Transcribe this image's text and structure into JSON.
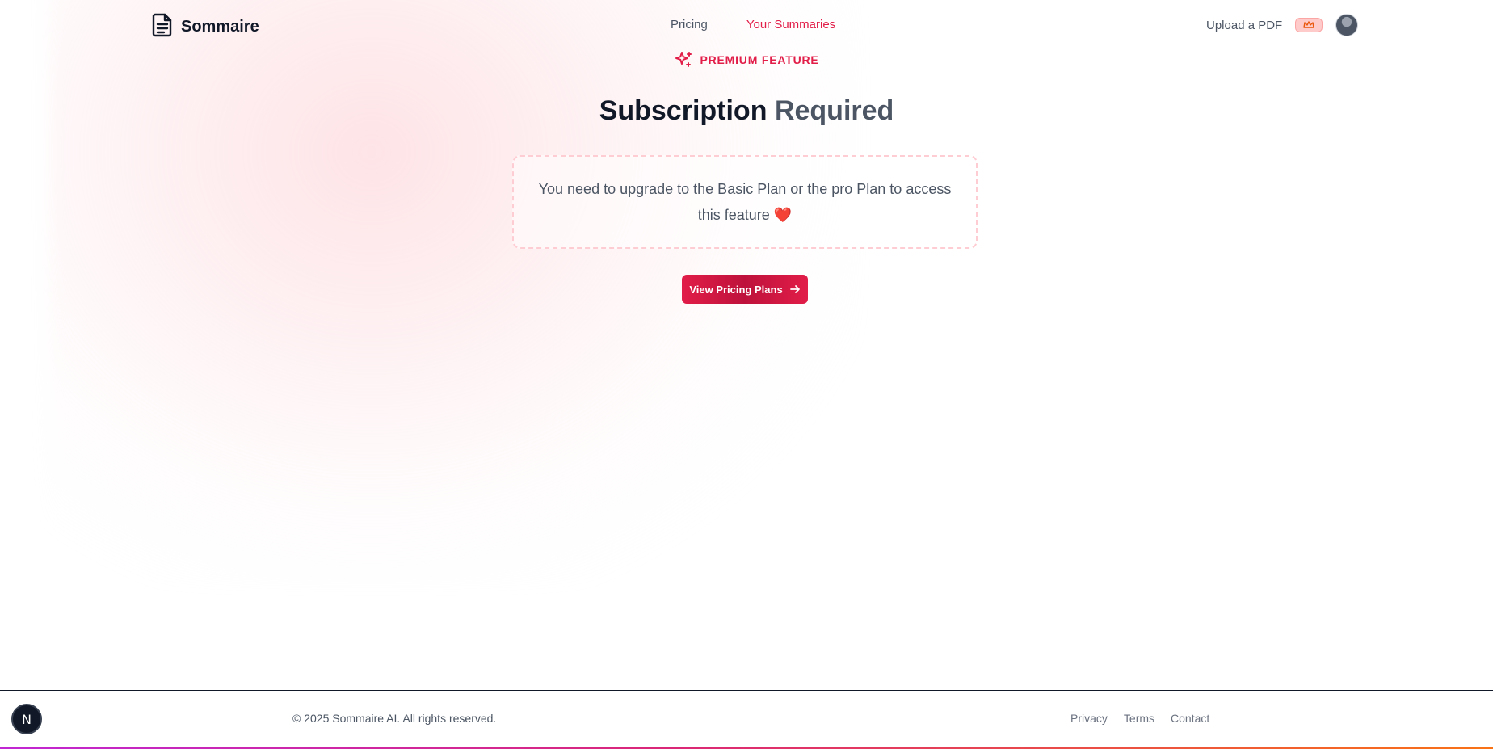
{
  "header": {
    "brand": "Sommaire",
    "nav": [
      {
        "label": "Pricing",
        "active": false
      },
      {
        "label": "Your Summaries",
        "active": true
      }
    ],
    "upload_label": "Upload a PDF"
  },
  "main": {
    "eyebrow": "PREMIUM FEATURE",
    "title_part1": "Subscription",
    "title_part2": "Required",
    "notice": "You need to upgrade to the Basic Plan or the pro Plan to access this feature ❤️",
    "cta_label": "View Pricing Plans"
  },
  "footer": {
    "copyright": "© 2025 Sommaire AI. All rights reserved.",
    "links": [
      "Privacy",
      "Terms",
      "Contact"
    ]
  },
  "dev_badge": "N",
  "colors": {
    "accent": "#e11d48",
    "text_dark": "#111827",
    "text_muted": "#4b5563"
  }
}
